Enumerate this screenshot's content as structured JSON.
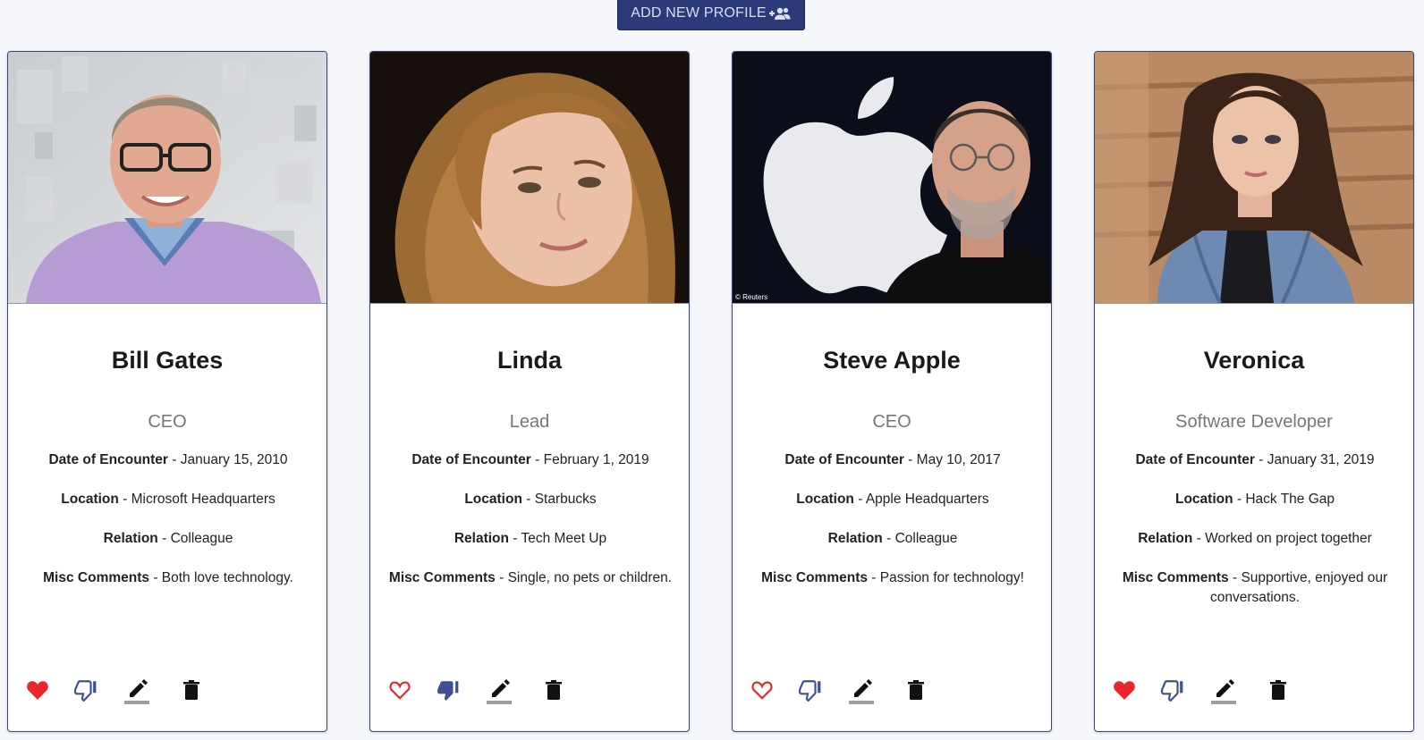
{
  "toolbar": {
    "add_profile_label": "ADD NEW PROFILE",
    "add_profile_icon": "add-group-icon"
  },
  "colors": {
    "accent": "#2d3a7a",
    "like_active": "#e8262b",
    "dislike": "#3e4f94"
  },
  "profiles": [
    {
      "name": "Bill Gates",
      "role": "CEO",
      "date_label": "Date of Encounter",
      "date": "January 15, 2010",
      "location_label": "Location",
      "location": "Microsoft Headquarters",
      "relation_label": "Relation",
      "relation": "Colleague",
      "comments_label": "Misc Comments",
      "comments": "Both love technology.",
      "liked": true,
      "disliked": false,
      "photo": "portrait-man-glasses-purple-sweater"
    },
    {
      "name": "Linda",
      "role": "Lead",
      "date_label": "Date of Encounter",
      "date": "February 1, 2019",
      "location_label": "Location",
      "location": "Starbucks",
      "relation_label": "Relation",
      "relation": "Tech Meet Up",
      "comments_label": "Misc Comments",
      "comments": "Single, no pets or children.",
      "liked": false,
      "disliked": true,
      "photo": "portrait-woman-blonde-hair"
    },
    {
      "name": "Steve Apple",
      "role": "CEO",
      "date_label": "Date of Encounter",
      "date": "May 10, 2017",
      "location_label": "Location",
      "location": "Apple Headquarters",
      "relation_label": "Relation",
      "relation": "Colleague",
      "comments_label": "Misc Comments",
      "comments": "Passion for technology!",
      "liked": false,
      "disliked": false,
      "photo": "portrait-man-apple-logo",
      "photo_credit": "© Reuters"
    },
    {
      "name": "Veronica",
      "role": "Software Developer",
      "date_label": "Date of Encounter",
      "date": "January 31, 2019",
      "location_label": "Location",
      "location": "Hack The Gap",
      "relation_label": "Relation",
      "relation": "Worked on project together",
      "comments_label": "Misc Comments",
      "comments": "Supportive, enjoyed our conversations.",
      "liked": true,
      "disliked": false,
      "photo": "portrait-woman-denim-jacket"
    }
  ]
}
